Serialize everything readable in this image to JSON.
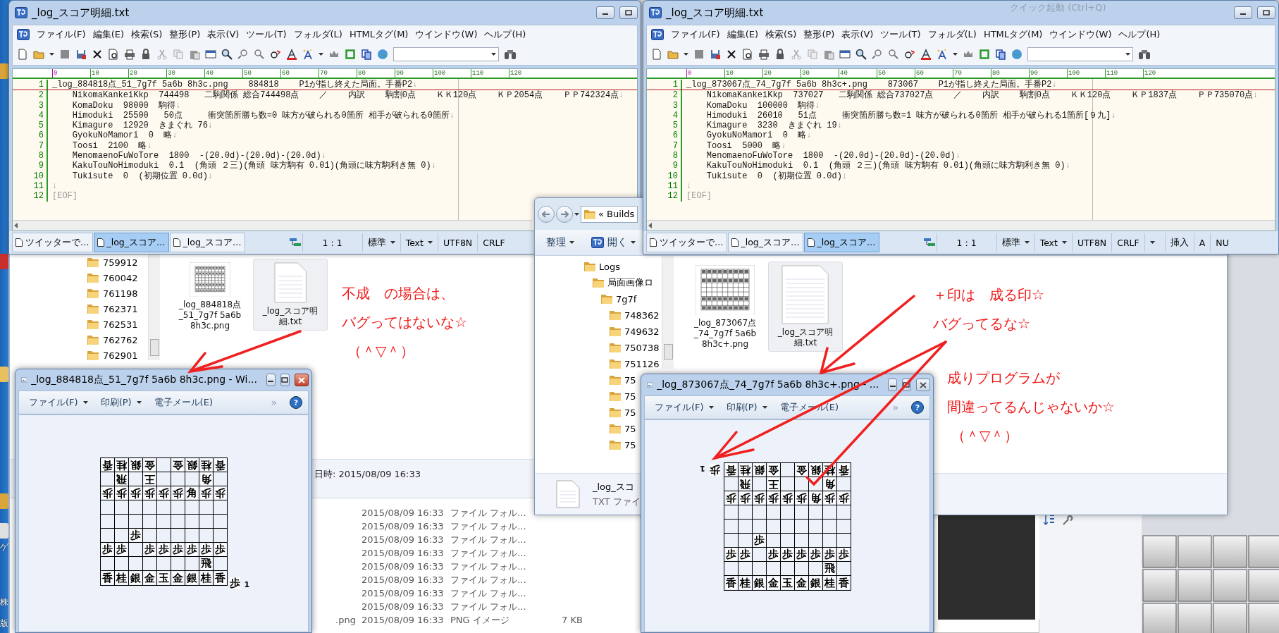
{
  "desktop": {
    "icon_labels": [
      "ゲ",
      "株",
      "版"
    ]
  },
  "editors": [
    {
      "title": "_log_スコア明細.txt",
      "menu": [
        "ファイル(F)",
        "編集(E)",
        "検索(S)",
        "整形(P)",
        "表示(V)",
        "ツール(T)",
        "フォルダ(L)",
        "HTMLタグ(M)",
        "ウインドウ(W)",
        "ヘルプ(H)"
      ],
      "ruler": [
        "0",
        "10",
        "20",
        "30",
        "40",
        "50",
        "60",
        "70",
        "80",
        "90",
        "100",
        "110",
        "120"
      ],
      "lines": [
        {
          "number": "1",
          "text": "_log_884818点_51_7g7f 5a6b 8h3c.png    884818    P1が指し終えた局面。手番P2",
          "eol": "↓",
          "current": true
        },
        {
          "number": "2",
          "text": "    NikomaKankeiKkp  744498   二駒関係 総合744498点    ／    内訳    駒割0点    ＫＫ120点    ＫＰ2054点    ＰＰ742324点",
          "eol": "↓",
          "current": false
        },
        {
          "number": "3",
          "text": "    KomaDoku  98000  駒得",
          "eol": "↓",
          "current": false
        },
        {
          "number": "4",
          "text": "    Himoduki  25500   50点     衝突箇所勝ち数=0 味方が破られる0箇所 相手が破られる0箇所",
          "eol": "↓",
          "current": false
        },
        {
          "number": "5",
          "text": "    Kimagure  12920  きまぐれ 76",
          "eol": "↓",
          "current": false
        },
        {
          "number": "6",
          "text": "    GyokuNoMamori  0  略",
          "eol": "↓",
          "current": false
        },
        {
          "number": "7",
          "text": "    Toosi  2100  略",
          "eol": "↓",
          "current": false
        },
        {
          "number": "8",
          "text": "    MenomaenoFuWoTore  1800  -(20.0d)-(20.0d)-(20.0d)",
          "eol": "↓",
          "current": false
        },
        {
          "number": "9",
          "text": "    KakuTouNoHimoduki  0.1  (角頭 ２三)(角頭 味方駒有 0.01)(角頭に味方駒利き無 0)",
          "eol": "↓",
          "current": false
        },
        {
          "number": "10",
          "text": "    Tukisute  0  (初期位置 0.0d)",
          "eol": "↓",
          "current": false
        },
        {
          "number": "11",
          "eol": "↓",
          "current": false
        },
        {
          "number": "12",
          "text": "[EOF]",
          "kind": "eof",
          "current": false
        }
      ],
      "tabs": [
        {
          "label": "ツイッターで…",
          "selected": false
        },
        {
          "label": "_log_スコア…",
          "selected": true
        },
        {
          "label": "_log_スコア…",
          "selected": false
        }
      ],
      "status": [
        {
          "kind": "text",
          "text": "1 : 1"
        },
        {
          "kind": "dropdown",
          "text": "標準"
        },
        {
          "kind": "dropdown",
          "text": "Text"
        },
        {
          "kind": "text",
          "text": "UTF8N"
        },
        {
          "kind": "text",
          "text": "CRLF"
        }
      ]
    },
    {
      "title": "_log_スコア明細.txt",
      "behind_text": "クイック起動 (Ctrl+Q)",
      "menu": [
        "ファイル(F)",
        "編集(E)",
        "検索(S)",
        "整形(P)",
        "表示(V)",
        "ツール(T)",
        "フォルダ(L)",
        "HTMLタグ(M)",
        "ウインドウ(W)",
        "ヘルプ(H)"
      ],
      "ruler": [
        "0",
        "10",
        "20",
        "30",
        "40",
        "50",
        "60",
        "70",
        "80",
        "90",
        "100",
        "110",
        "120"
      ],
      "lines": [
        {
          "number": "1",
          "text": "_log_873067点_74_7g7f 5a6b 8h3c+.png    873067    P1が指し終えた局面。手番P2",
          "eol": "↓",
          "current": true
        },
        {
          "number": "2",
          "text": "    NikomaKankeiKkp  737027   二駒関係 総合737027点    ／    内訳    駒割0点    ＫＫ120点    ＫＰ1837点    ＰＰ735070点",
          "eol": "↓",
          "current": false
        },
        {
          "number": "3",
          "text": "    KomaDoku  100000  駒得",
          "eol": "↓",
          "current": false
        },
        {
          "number": "4",
          "text": "    Himoduki  26010   51点     衝突箇所勝ち数=1 味方が破られる0箇所 相手が破られる1箇所[９九]",
          "eol": "↓",
          "current": false
        },
        {
          "number": "5",
          "text": "    Kimagure  3230  きまぐれ 19",
          "eol": "↓",
          "current": false
        },
        {
          "number": "6",
          "text": "    GyokuNoMamori  0  略",
          "eol": "↓",
          "current": false
        },
        {
          "number": "7",
          "text": "    Toosi  5000  略",
          "eol": "↓",
          "current": false
        },
        {
          "number": "8",
          "text": "    MenomaenoFuWoTore  1800  -(20.0d)-(20.0d)-(20.0d)",
          "eol": "↓",
          "current": false
        },
        {
          "number": "9",
          "text": "    KakuTouNoHimoduki  0.1  (角頭 ２三)(角頭 味方駒有 0.01)(角頭に味方駒利き無 0)",
          "eol": "↓",
          "current": false
        },
        {
          "number": "10",
          "text": "    Tukisute  0  (初期位置 0.0d)",
          "eol": "↓",
          "current": false
        },
        {
          "number": "11",
          "eol": "↓",
          "current": false
        },
        {
          "number": "12",
          "text": "[EOF]",
          "kind": "eof",
          "current": false
        }
      ],
      "tabs": [
        {
          "label": "ツイッターで…",
          "selected": false
        },
        {
          "label": "_log_スコア…",
          "selected": false
        },
        {
          "label": "_log_スコア…",
          "selected": true
        }
      ],
      "status": [
        {
          "kind": "text",
          "text": "1 : 1"
        },
        {
          "kind": "dropdown",
          "text": "標準"
        },
        {
          "kind": "dropdown",
          "text": "Text"
        },
        {
          "kind": "text",
          "text": "UTF8N"
        },
        {
          "kind": "text",
          "text": "CRLF"
        },
        {
          "kind": "dropdown"
        },
        {
          "kind": "text",
          "text": "挿入"
        },
        {
          "kind": "text",
          "text": "A"
        },
        {
          "kind": "text",
          "text": "NU"
        }
      ]
    }
  ],
  "back_explorer": {
    "folders": [
      "759912",
      "760042",
      "761198",
      "762371",
      "762531",
      "762762",
      "762901"
    ],
    "files": [
      {
        "kind": "image",
        "name": "_log_884818点_51_7g7f 5a6b 8h3c.png",
        "selected": false
      },
      {
        "kind": "text",
        "name": "_log_スコア明細.txt",
        "selected": true
      }
    ],
    "details": "日時: 2015/08/09 16:33",
    "rows": [
      {
        "date": "2015/08/09 16:33",
        "type": "ファイル フォル..."
      },
      {
        "date": "2015/08/09 16:33",
        "type": "ファイル フォル..."
      },
      {
        "date": "2015/08/09 16:33",
        "type": "ファイル フォル..."
      },
      {
        "date": "2015/08/09 16:33",
        "type": "ファイル フォル..."
      },
      {
        "date": "2015/08/09 16:33",
        "type": "ファイル フォル..."
      },
      {
        "date": "2015/08/09 16:33",
        "type": "ファイル フォル..."
      },
      {
        "date": "2015/08/09 16:33",
        "type": "ファイル フォル..."
      },
      {
        "date": "2015/08/09 16:33",
        "type": "ファイル フォル..."
      },
      {
        "name": ".png",
        "date": "2015/08/09 16:33",
        "type": "PNG イメージ",
        "size": "7 KB"
      }
    ]
  },
  "mid_explorer": {
    "address_prefix": "«",
    "address": "Builds",
    "toolbar": [
      {
        "label": "整理",
        "icon": false
      },
      {
        "label": "開く",
        "icon": true
      }
    ],
    "tree": [
      {
        "label": "Logs",
        "children": [
          {
            "label": "局面画像ロ",
            "children": [
              {
                "label": "7g7f",
                "children": [
                  {
                    "label": "748362"
                  },
                  {
                    "label": "749632"
                  },
                  {
                    "label": "750738"
                  },
                  {
                    "label": "751126"
                  },
                  {
                    "label": "75"
                  },
                  {
                    "label": "75"
                  },
                  {
                    "label": "75"
                  },
                  {
                    "label": "75"
                  },
                  {
                    "label": "75"
                  }
                ]
              }
            ]
          }
        ]
      }
    ],
    "files": [
      {
        "kind": "image",
        "name": "_log_873067点_74_7g7f 5a6b 8h3c+.png",
        "selected": false
      },
      {
        "kind": "text",
        "name": "_log_スコア明細.txt",
        "selected": true
      }
    ],
    "details": {
      "name": "_log_スコ",
      "type": "TXT ファイ"
    }
  },
  "viewers": [
    {
      "title": "_log_884818点_51_7g7f 5a6b 8h3c.png - Wi...",
      "close_hot": true,
      "menu": [
        {
          "label": "ファイル(F)",
          "dropdown": true
        },
        {
          "label": "印刷(P)",
          "dropdown": true
        },
        {
          "label": "電子メール(E)",
          "dropdown": false
        }
      ],
      "more": "»",
      "help": "?",
      "board": {
        "rows": [
          [
            {
              "piece": "香",
              "gote": true
            },
            {
              "piece": "桂",
              "gote": true
            },
            {
              "piece": "銀",
              "gote": true
            },
            {
              "piece": "金",
              "gote": true
            },
            null,
            {
              "piece": "金",
              "gote": true
            },
            {
              "piece": "銀",
              "gote": true
            },
            {
              "piece": "桂",
              "gote": true
            },
            {
              "piece": "香",
              "gote": true
            }
          ],
          [
            null,
            {
              "piece": "飛",
              "gote": true
            },
            null,
            {
              "piece": "王",
              "gote": true
            },
            null,
            null,
            null,
            {
              "piece": "角",
              "gote": true
            },
            null
          ],
          [
            {
              "piece": "歩",
              "gote": true
            },
            {
              "piece": "歩",
              "gote": true
            },
            {
              "piece": "歩",
              "gote": true
            },
            {
              "piece": "歩",
              "gote": true
            },
            {
              "piece": "歩",
              "gote": true
            },
            {
              "piece": "歩",
              "gote": true
            },
            {
              "piece": "角",
              "gote": false
            },
            {
              "piece": "歩",
              "gote": true
            },
            {
              "piece": "歩",
              "gote": true
            }
          ],
          [
            null,
            null,
            null,
            null,
            null,
            null,
            null,
            null,
            null
          ],
          [
            null,
            null,
            null,
            null,
            null,
            null,
            null,
            null,
            null
          ],
          [
            null,
            null,
            {
              "piece": "歩",
              "gote": false
            },
            null,
            null,
            null,
            null,
            null,
            null
          ],
          [
            {
              "piece": "歩",
              "gote": false
            },
            {
              "piece": "歩",
              "gote": false
            },
            null,
            {
              "piece": "歩",
              "gote": false
            },
            {
              "piece": "歩",
              "gote": false
            },
            {
              "piece": "歩",
              "gote": false
            },
            {
              "piece": "歩",
              "gote": false
            },
            {
              "piece": "歩",
              "gote": false
            },
            {
              "piece": "歩",
              "gote": false
            }
          ],
          [
            null,
            null,
            null,
            null,
            null,
            null,
            null,
            {
              "piece": "飛",
              "gote": false
            },
            null
          ],
          [
            {
              "piece": "香",
              "gote": false
            },
            {
              "piece": "桂",
              "gote": false
            },
            {
              "piece": "銀",
              "gote": false
            },
            {
              "piece": "金",
              "gote": false
            },
            {
              "piece": "玉",
              "gote": false
            },
            {
              "piece": "金",
              "gote": false
            },
            {
              "piece": "銀",
              "gote": false
            },
            {
              "piece": "桂",
              "gote": false
            },
            {
              "piece": "香",
              "gote": false
            }
          ]
        ],
        "hand": {
          "piece": "歩",
          "count": "1",
          "gote": false
        }
      }
    },
    {
      "title": "_log_873067点_74_7g7f 5a6b 8h3c+.png - ...",
      "close_hot": false,
      "menu": [
        {
          "label": "ファイル(F)",
          "dropdown": true
        },
        {
          "label": "印刷(P)",
          "dropdown": true
        },
        {
          "label": "電子メール(E)",
          "dropdown": false
        }
      ],
      "more": "»",
      "help": "?",
      "board": {
        "rows": [
          [
            {
              "piece": "香",
              "gote": true
            },
            {
              "piece": "桂",
              "gote": true
            },
            {
              "piece": "銀",
              "gote": true
            },
            {
              "piece": "金",
              "gote": true
            },
            null,
            {
              "piece": "金",
              "gote": true
            },
            {
              "piece": "銀",
              "gote": true
            },
            {
              "piece": "桂",
              "gote": true
            },
            {
              "piece": "香",
              "gote": true
            }
          ],
          [
            null,
            {
              "piece": "飛",
              "gote": true
            },
            null,
            {
              "piece": "王",
              "gote": true
            },
            null,
            null,
            null,
            {
              "piece": "角",
              "gote": true
            },
            null
          ],
          [
            {
              "piece": "歩",
              "gote": true
            },
            {
              "piece": "歩",
              "gote": true
            },
            {
              "piece": "歩",
              "gote": true
            },
            {
              "piece": "歩",
              "gote": true
            },
            {
              "piece": "歩",
              "gote": true
            },
            {
              "piece": "歩",
              "gote": true
            },
            {
              "piece": "角",
              "gote": true
            },
            {
              "piece": "歩",
              "gote": true
            },
            {
              "piece": "歩",
              "gote": true
            }
          ],
          [
            null,
            null,
            null,
            null,
            null,
            null,
            null,
            null,
            null
          ],
          [
            null,
            null,
            null,
            null,
            null,
            null,
            null,
            null,
            null
          ],
          [
            null,
            null,
            {
              "piece": "歩",
              "gote": false
            },
            null,
            null,
            null,
            null,
            null,
            null
          ],
          [
            {
              "piece": "歩",
              "gote": false
            },
            {
              "piece": "歩",
              "gote": false
            },
            null,
            {
              "piece": "歩",
              "gote": false
            },
            {
              "piece": "歩",
              "gote": false
            },
            {
              "piece": "歩",
              "gote": false
            },
            {
              "piece": "歩",
              "gote": false
            },
            {
              "piece": "歩",
              "gote": false
            },
            {
              "piece": "歩",
              "gote": false
            }
          ],
          [
            null,
            null,
            null,
            null,
            null,
            null,
            null,
            {
              "piece": "飛",
              "gote": false
            },
            null
          ],
          [
            {
              "piece": "香",
              "gote": false
            },
            {
              "piece": "桂",
              "gote": false
            },
            {
              "piece": "銀",
              "gote": false
            },
            {
              "piece": "金",
              "gote": false
            },
            {
              "piece": "玉",
              "gote": false
            },
            {
              "piece": "金",
              "gote": false
            },
            {
              "piece": "銀",
              "gote": false
            },
            {
              "piece": "桂",
              "gote": false
            },
            {
              "piece": "香",
              "gote": false
            }
          ]
        ],
        "hand": {
          "piece": "歩",
          "count": "1",
          "gote": true
        }
      }
    }
  ],
  "annotations": [
    {
      "lines": [
        "不成　の場合は、",
        "バグってはないな☆",
        "（＾▽＾）"
      ]
    },
    {
      "lines": [
        "＋印は　成る印☆",
        "バグってるな☆"
      ]
    },
    {
      "lines": [
        "成りプログラムが",
        "間違ってるんじゃないか☆",
        "（＾▽＾）"
      ]
    }
  ]
}
